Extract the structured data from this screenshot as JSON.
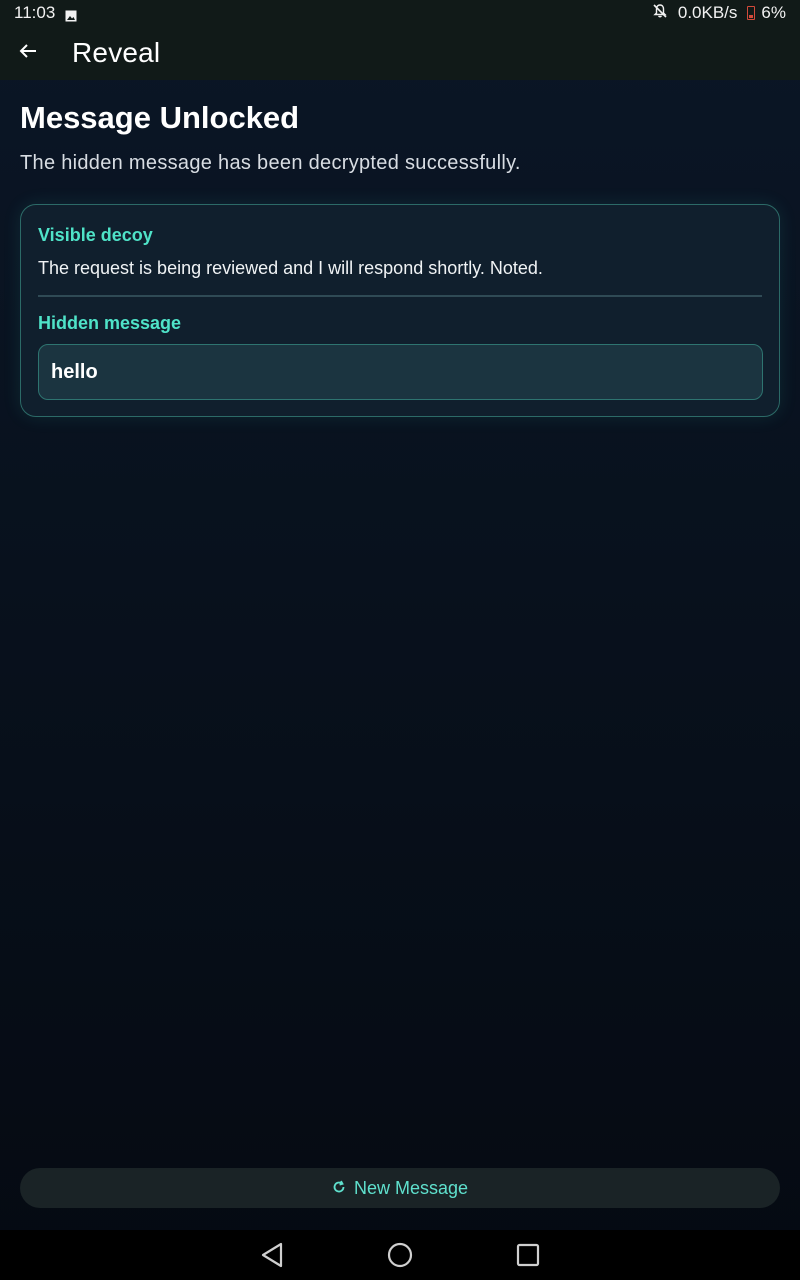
{
  "status_bar": {
    "time": "11:03",
    "network_speed": "0.0KB/s",
    "battery": "6%",
    "icons": [
      "image-icon",
      "notifications-off-icon",
      "battery-low-icon"
    ]
  },
  "app_bar": {
    "title": "Reveal",
    "back_icon": "arrow-back-icon"
  },
  "main": {
    "title": "Message Unlocked",
    "subtitle": "The hidden message has been decrypted successfully.",
    "card": {
      "decoy_label": "Visible decoy",
      "decoy_text": "The request is being reviewed and I will respond shortly. Noted.",
      "hidden_label": "Hidden message",
      "hidden_text": "hello"
    }
  },
  "footer": {
    "new_message_label": "New Message",
    "new_message_icon": "refresh-icon"
  },
  "nav_bar": {
    "items": [
      "back-nav-icon",
      "home-nav-icon",
      "recents-nav-icon"
    ]
  },
  "colors": {
    "accent": "#4fe3c8",
    "background": "#08111d",
    "card_border": "#2c6a67",
    "battery_low": "#d24a3a"
  }
}
